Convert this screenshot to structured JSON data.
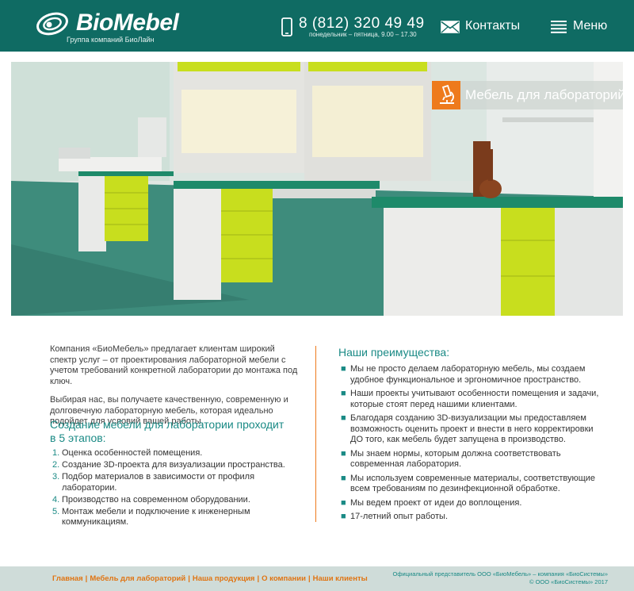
{
  "header": {
    "brand": "BioMebel",
    "tagline": "Группа компаний БиоЛайн",
    "phone": "8 (812) 320 49 49",
    "hours": "понедельник – пятница, 9.00 – 17.30",
    "contacts_label": "Контакты",
    "menu_label": "Меню"
  },
  "hero": {
    "badge_label": "Мебель для лабораторий"
  },
  "intro": {
    "p1": "Компания «БиоМебель» предлагает клиентам широкий спектр услуг – от проектирования лабораторной мебели с учетом требований конкретной лаборатории до монтажа под ключ.",
    "p2": "Выбирая нас, вы получаете качественную, современную и долговечную лабораторную мебель, которая идеально подойдет для условий вашей работы."
  },
  "stages": {
    "title": "Создание мебели для лаборатории проходит в 5 этапов:",
    "items": [
      {
        "num": "1.",
        "text": "Оценка особенностей помещения."
      },
      {
        "num": "2.",
        "text": "Создание 3D-проекта для визуализации пространства."
      },
      {
        "num": "3.",
        "text": "Подбор материалов в зависимости от профиля лаборатории."
      },
      {
        "num": "4.",
        "text": "Производство на современном оборудовании."
      },
      {
        "num": "5.",
        "text": "Монтаж мебели и подключение к инженерным коммуникациям."
      }
    ]
  },
  "advantages": {
    "title": "Наши преимущества:",
    "bullet": "■",
    "items": [
      "Мы не просто делаем лабораторную мебель, мы создаем удобное функциональное и эргономичное пространство.",
      "Наши проекты учитывают особенности помещения и задачи, которые стоят перед нашими клиентами.",
      "Благодаря созданию 3D-визуализации мы предоставляем возможность оценить проект и внести в него корректировки ДО того, как мебель будет запущена в производство.",
      "Мы знаем нормы, которым должна соответствовать современная лаборатория.",
      "Мы используем современные материалы, соответствующие всем требованиям по дезинфекционной обработке.",
      "Мы ведем проект от идеи до воплощения.",
      "17-летний опыт работы."
    ]
  },
  "footer": {
    "nav": [
      "Главная",
      "Мебель для лабораторий",
      "Наша продукция",
      "О компании",
      "Наши клиенты"
    ],
    "separator": "|",
    "official": "Официальный представитель ООО «БиоМебель» – компания «БиоСистемы»",
    "copyright": "© ООО «БиоСистемы» 2017"
  },
  "colors": {
    "header_bg": "#0f6b63",
    "accent_orange": "#ee7a1c",
    "accent_teal": "#1a8a85",
    "footer_bg": "#cfdcd9",
    "lab_yellow": "#c8de1e"
  },
  "icons": {
    "logo": "biomebel-logo-icon",
    "phone": "mobile-phone-icon",
    "contacts": "envelope-icon",
    "menu": "hamburger-menu-icon",
    "badge": "microscope-icon"
  }
}
